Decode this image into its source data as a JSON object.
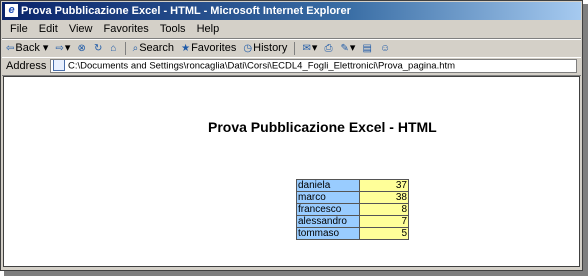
{
  "window": {
    "title": "Prova Pubblicazione Excel - HTML - Microsoft Internet Explorer"
  },
  "menu": [
    "File",
    "Edit",
    "View",
    "Favorites",
    "Tools",
    "Help"
  ],
  "toolbar": {
    "back": "Back",
    "search": "Search",
    "favorites": "Favorites",
    "history": "History"
  },
  "address": {
    "label": "Address",
    "value": "C:\\Documents and Settings\\roncaglia\\Dati\\Corsi\\ECDL4_Fogli_Elettronici\\Prova_pagina.htm"
  },
  "page": {
    "heading": "Prova Pubblicazione Excel - HTML",
    "rows": [
      {
        "name": "daniela",
        "value": "37"
      },
      {
        "name": "marco",
        "value": "38"
      },
      {
        "name": "francesco",
        "value": "8"
      },
      {
        "name": "alessandro",
        "value": "7"
      },
      {
        "name": "tommaso",
        "value": "5"
      }
    ]
  }
}
